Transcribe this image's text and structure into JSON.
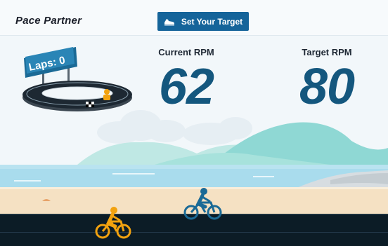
{
  "app": {
    "title": "Pace Partner"
  },
  "header": {
    "target_button_label": "Set Your Target",
    "target_button_icon": "shoe-icon"
  },
  "laps": {
    "label": "Laps: 0"
  },
  "stats": {
    "current": {
      "label": "Current RPM",
      "value": "62"
    },
    "target": {
      "label": "Target RPM",
      "value": "80"
    }
  },
  "colors": {
    "accent": "#15649a",
    "number": "#14577e",
    "rider_user": "#f2a20f",
    "rider_partner": "#1b6a96",
    "road": "#0c1c26",
    "sand": "#f4dfc0",
    "water": "#9fd6ea"
  }
}
